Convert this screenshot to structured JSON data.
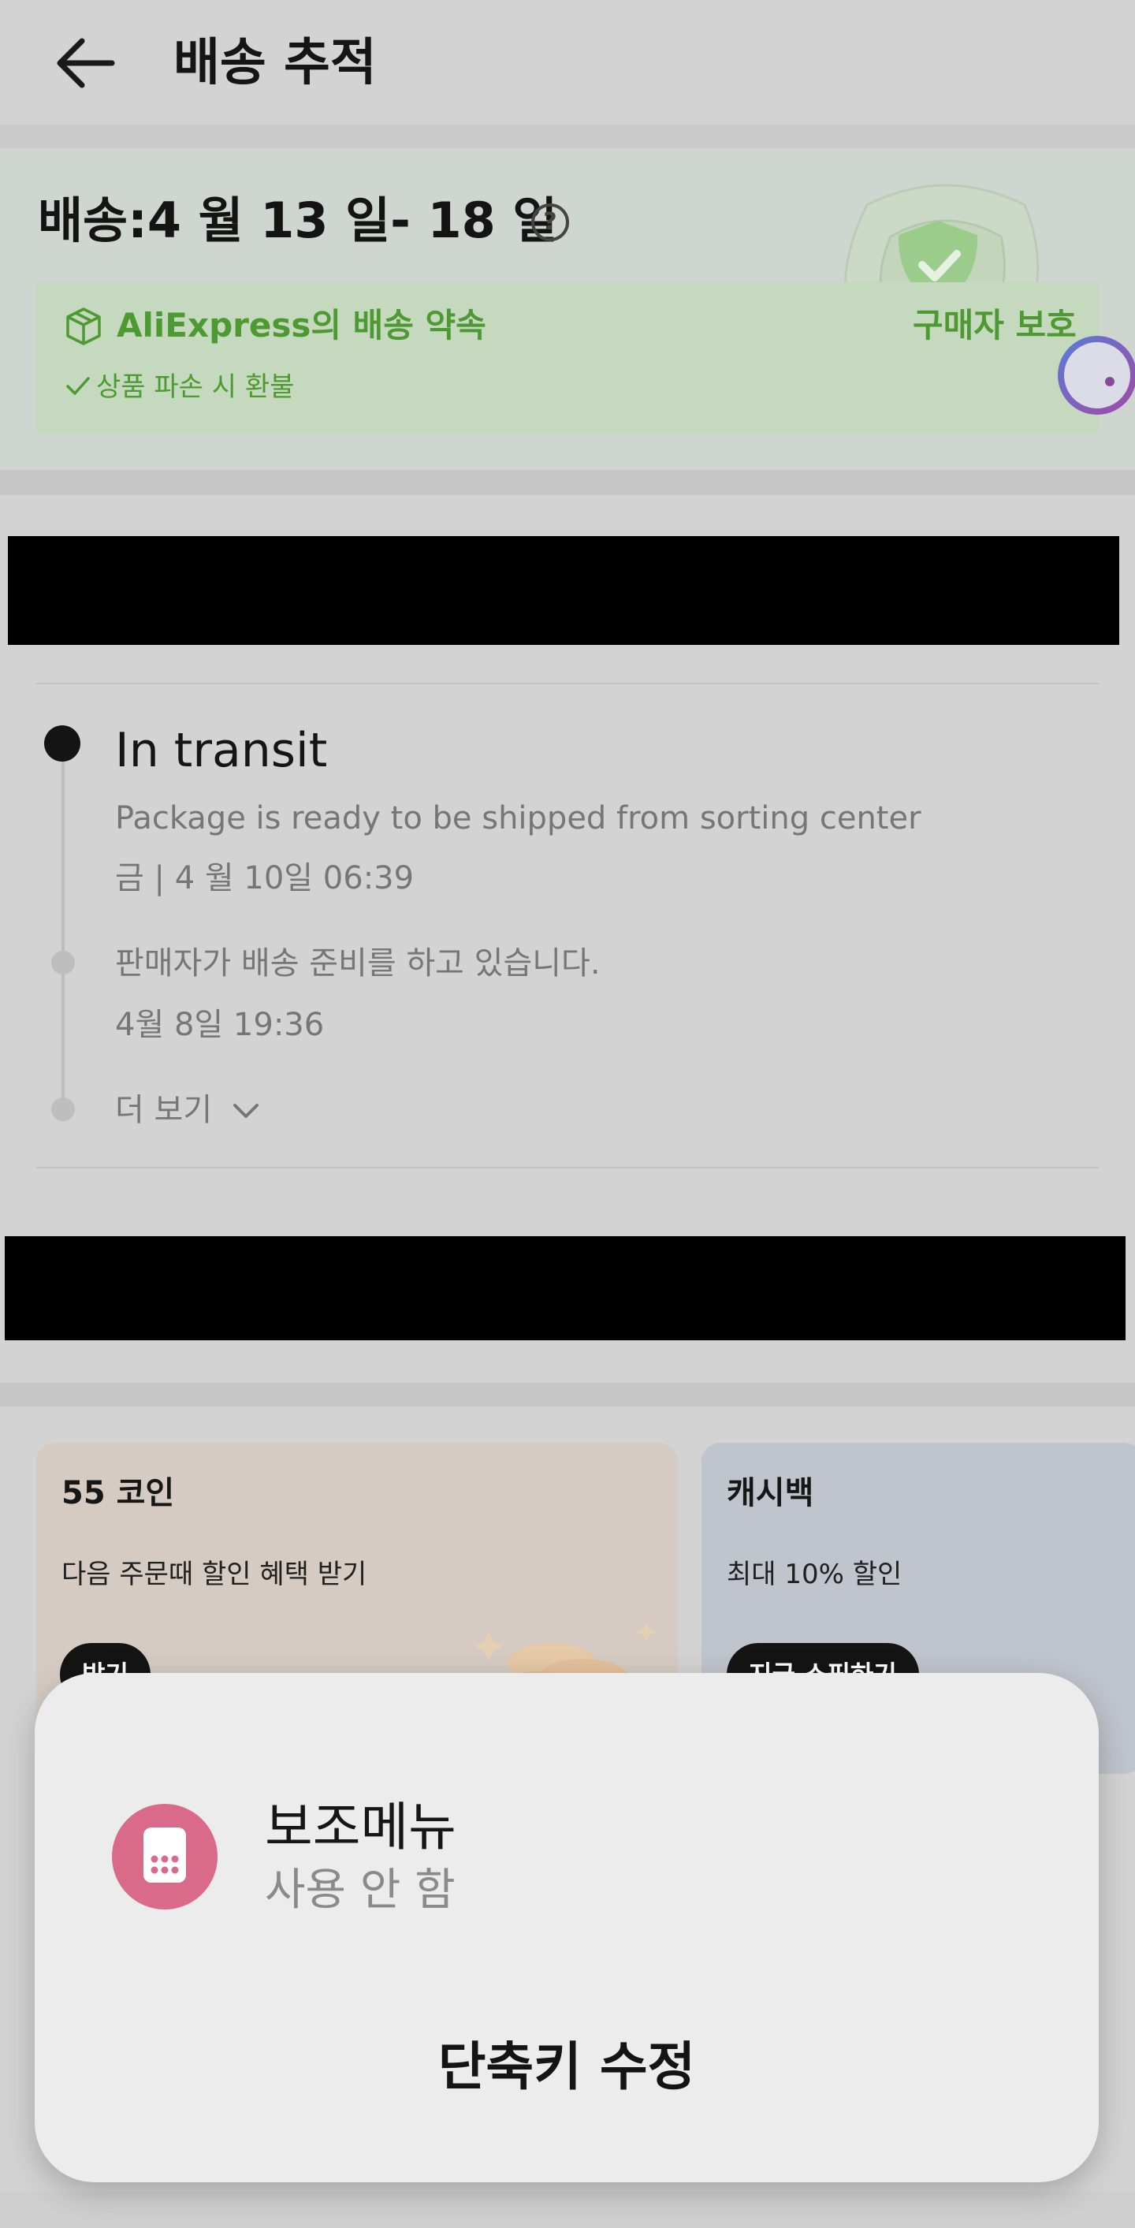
{
  "header": {
    "title": "배송 추적",
    "back_icon": "arrow-left-icon"
  },
  "delivery": {
    "title": "배송:4 월 13 일- 18 일",
    "help_glyph": "?",
    "promise_title": "AliExpress의 배송 약속",
    "refund_text": "상품 파손 시 환불",
    "buyer_protection": "구매자 보호",
    "accent_color": "#4e9a32"
  },
  "tracking": {
    "status": "In transit",
    "events": [
      {
        "text": "Package is ready to be shipped from  sorting center",
        "time": "금 | 4 월 10일 06:39"
      },
      {
        "text": "판매자가 배송 준비를 하고 있습니다.",
        "time": "4월 8일 19:36"
      }
    ],
    "more_label": "더 보기"
  },
  "promos": [
    {
      "title": "55 코인",
      "desc": "다음 주문때 할인 혜택 받기",
      "button": "받기"
    },
    {
      "title": "캐시백",
      "desc": "최대 10% 할인",
      "button": "지금 쇼핑하기"
    }
  ],
  "popup": {
    "title": "보조메뉴",
    "subtitle": "사용 안 함",
    "action": "단축키 수정",
    "icon_color": "#d96a89"
  }
}
